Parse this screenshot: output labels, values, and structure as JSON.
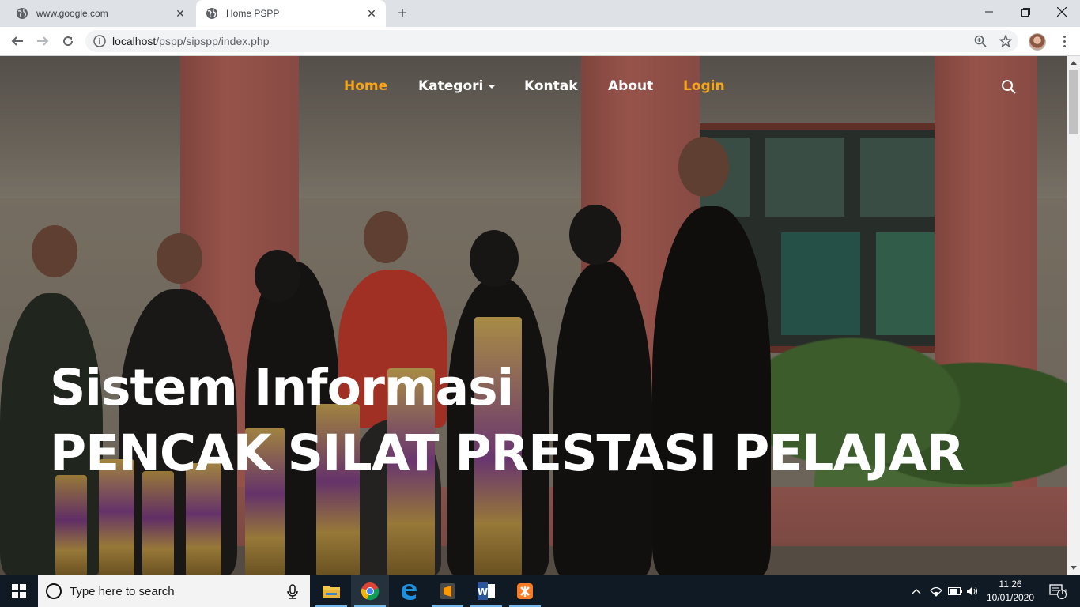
{
  "browser": {
    "tabs": [
      {
        "title": "www.google.com",
        "active": false
      },
      {
        "title": "Home PSPP",
        "active": true
      }
    ],
    "url_host": "localhost",
    "url_path": "/pspp/sipspp/index.php"
  },
  "site": {
    "nav": {
      "home": "Home",
      "kategori": "Kategori",
      "kontak": "Kontak",
      "about": "About",
      "login": "Login"
    },
    "accent_color": "#f6a51a",
    "hero": {
      "line1": "Sistem Informasi",
      "line2": "PENCAK SILAT PRESTASI PELAJAR"
    }
  },
  "taskbar": {
    "search_placeholder": "Type here to search",
    "apps": [
      "file-explorer",
      "chrome",
      "edge",
      "sublime-text",
      "word",
      "xampp"
    ],
    "time": "11:26",
    "date": "10/01/2020",
    "notification_count": "11"
  }
}
